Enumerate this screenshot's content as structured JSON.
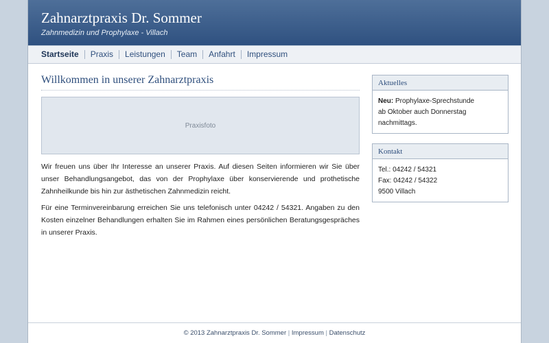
{
  "header": {
    "title": "Zahnarztpraxis Dr. Sommer",
    "subtitle": "Zahnmedizin und Prophylaxe - Villach"
  },
  "nav": {
    "items": [
      "Startseite",
      "Praxis",
      "Leistungen",
      "Team",
      "Anfahrt",
      "Impressum"
    ],
    "active": "Startseite"
  },
  "main": {
    "title": "Willkommen in unserer Zahnarztpraxis",
    "photo_label": "Praxisfoto",
    "paragraphs": [
      "Wir freuen uns über Ihr Interesse an unserer Praxis. Auf diesen Seiten informieren wir Sie über unser Behandlungsangebot, das von der Prophylaxe über konservierende und prothetische Zahnheilkunde bis hin zur ästhetischen Zahnmedizin reicht.",
      "Für eine Terminvereinbarung erreichen Sie uns telefonisch unter 04242 / 54321. Angaben zu den Kosten einzelner Behandlungen erhalten Sie im Rahmen eines persönlichen Beratungsgespräches in unserer Praxis."
    ]
  },
  "sidebar": {
    "news": {
      "title": "Aktuelles",
      "label": "Neu:",
      "line1": "Prophylaxe-Sprechstunde",
      "line2": "ab Oktober auch Donnerstag",
      "line3": "nachmittags."
    },
    "contact": {
      "title": "Kontakt",
      "phone": "Tel.: 04242 / 54321",
      "fax": "Fax: 04242 / 54322",
      "city": "9500 Villach"
    }
  },
  "footer": {
    "copyright": "© 2013 Zahnarztpraxis Dr. Sommer",
    "separator": "|",
    "link_impressum": "Impressum",
    "link_datenschutz": "Datenschutz"
  }
}
